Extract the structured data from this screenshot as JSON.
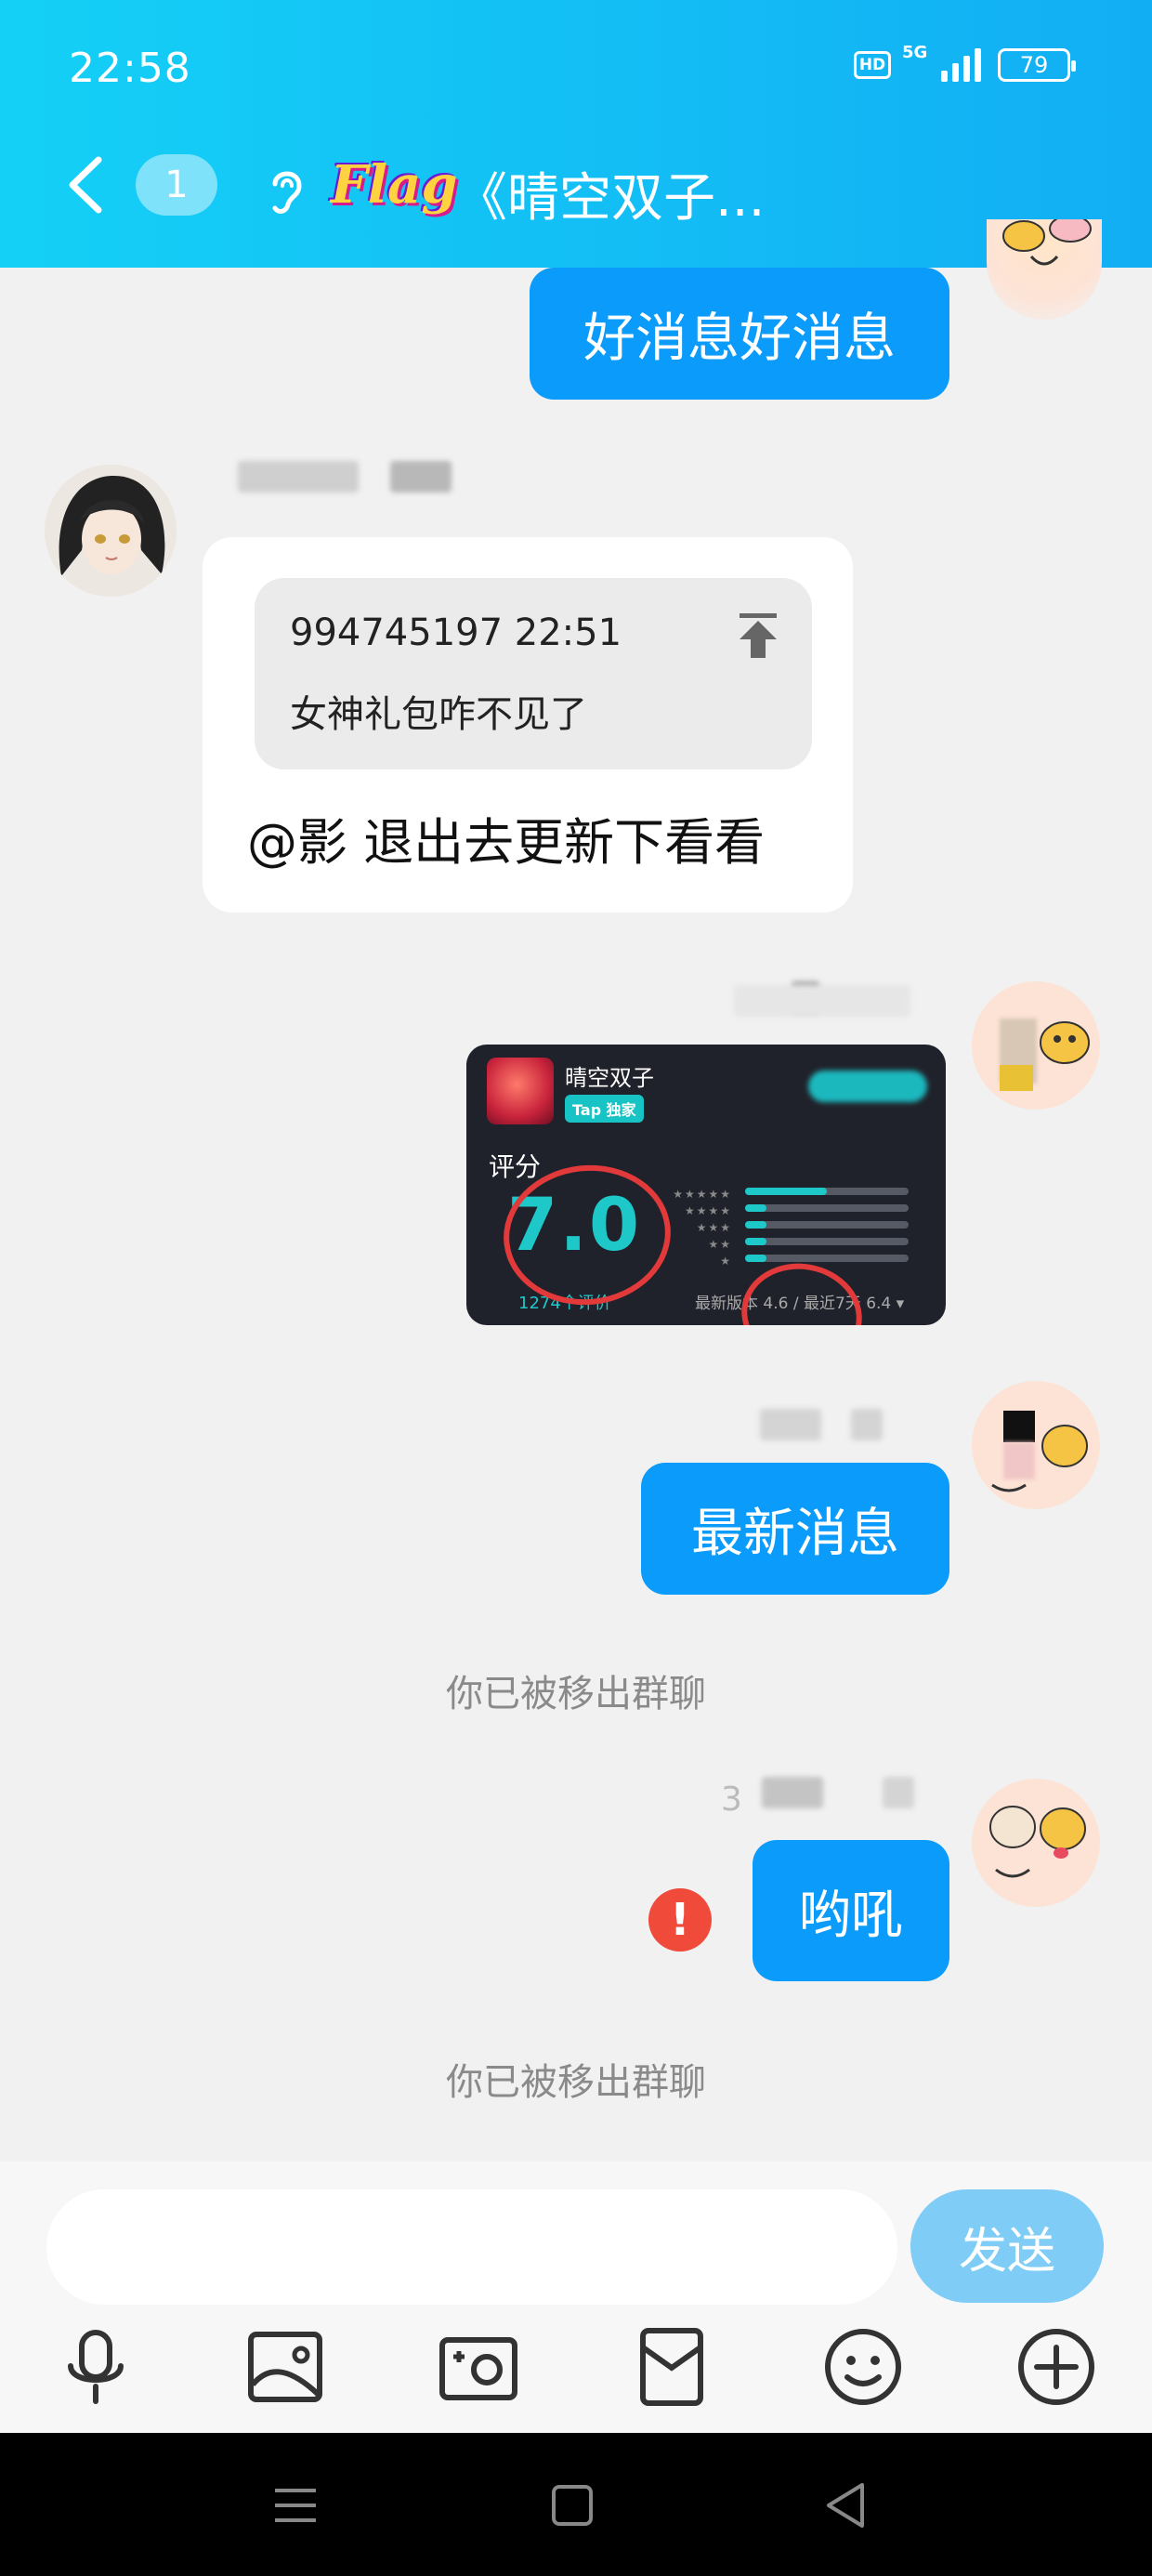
{
  "status_bar": {
    "time": "22:58",
    "hd": "HD",
    "network": "5G",
    "battery": "79"
  },
  "header": {
    "unread_count": "1",
    "logo_text": "Flag",
    "title": "《晴空双子..."
  },
  "messages": {
    "m1_text": "好消息好消息",
    "reply_quote_meta": "994745197 22:51",
    "reply_quote_text": "女神礼包咋不见了",
    "reply_text": "@影 退出去更新下看看",
    "image_card": {
      "app_name": "晴空双子",
      "badge": "Tap 独家",
      "rating_label": "评分",
      "rating_value": "7.0",
      "rating_count": "1274个评价",
      "versions": "最新版本 4.6 / 最近7天 6.4 ▾",
      "star_rows": [
        "★★★★★",
        "★★★★",
        "★★★",
        "★★",
        "★"
      ],
      "distribution": [
        0.5,
        0.13,
        0.13,
        0.13,
        0.13
      ]
    },
    "m4_text": "最新消息",
    "system_1": "你已被移出群聊",
    "m5_text": "哟吼",
    "system_2": "你已被移出群聊",
    "partial_name_char": "3"
  },
  "input": {
    "placeholder": "",
    "send_label": "发送"
  },
  "toolbar": [
    "mic-icon",
    "image-icon",
    "camera-icon",
    "red-packet-icon",
    "emoji-icon",
    "plus-icon"
  ],
  "colors": {
    "header_start": "#14d0f6",
    "header_end": "#12aef4",
    "bubble": "#0b9bfa",
    "send": "#7fccf6",
    "error": "#f04a3b",
    "accent_teal": "#1fc8c8"
  }
}
